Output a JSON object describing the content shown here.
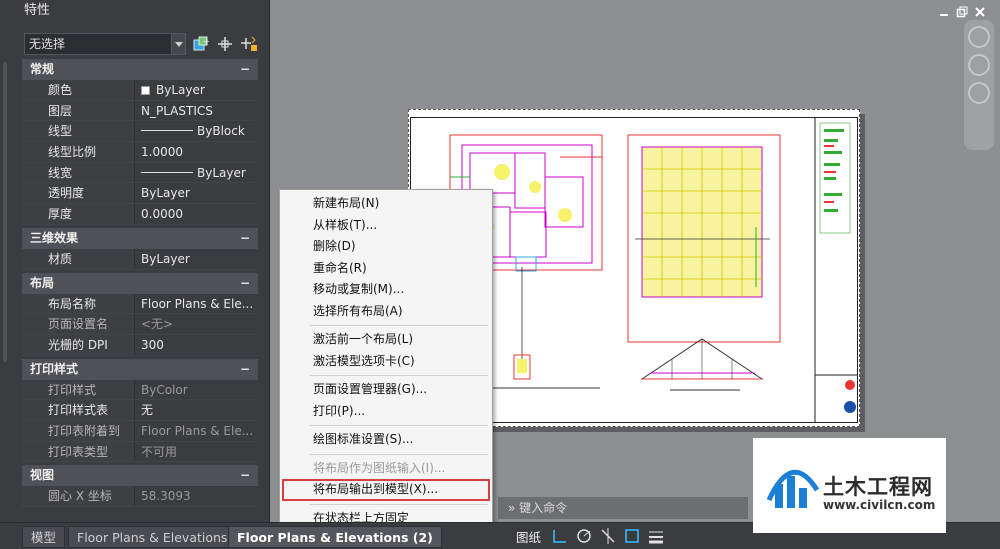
{
  "palette": {
    "title": "特性",
    "selection": "无选择",
    "sections": [
      {
        "header": "常规",
        "rows": [
          {
            "name": "颜色",
            "value": "ByLayer",
            "kind": "color"
          },
          {
            "name": "图层",
            "value": "N_PLASTICS"
          },
          {
            "name": "线型",
            "value": "ByBlock",
            "kind": "line"
          },
          {
            "name": "线型比例",
            "value": "1.0000"
          },
          {
            "name": "线宽",
            "value": "ByLayer",
            "kind": "line"
          },
          {
            "name": "透明度",
            "value": "ByLayer"
          },
          {
            "name": "厚度",
            "value": "0.0000"
          }
        ]
      },
      {
        "header": "三维效果",
        "rows": [
          {
            "name": "材质",
            "value": "ByLayer"
          }
        ]
      },
      {
        "header": "布局",
        "rows": [
          {
            "name": "布局名称",
            "value": "Floor Plans & Ele..."
          },
          {
            "name": "页面设置名",
            "value": "<无>",
            "dim": true
          },
          {
            "name": "光栅的 DPI",
            "value": "300"
          }
        ]
      },
      {
        "header": "打印样式",
        "rows": [
          {
            "name": "打印样式",
            "value": "ByColor",
            "dim": true
          },
          {
            "name": "打印样式表",
            "value": "无"
          },
          {
            "name": "打印表附着到",
            "value": "Floor Plans & Ele...",
            "dim": true
          },
          {
            "name": "打印表类型",
            "value": "不可用",
            "dim": true
          }
        ]
      },
      {
        "header": "视图",
        "rows": [
          {
            "name": "圆心 X 坐标",
            "value": "58.3093",
            "dim": true
          }
        ]
      }
    ],
    "collapse_glyph": "−"
  },
  "context_menu": {
    "items": [
      {
        "label": "新建布局(N)"
      },
      {
        "label": "从样板(T)..."
      },
      {
        "label": "删除(D)"
      },
      {
        "label": "重命名(R)"
      },
      {
        "label": "移动或复制(M)..."
      },
      {
        "label": "选择所有布局(A)"
      },
      {
        "sep": true
      },
      {
        "label": "激活前一个布局(L)"
      },
      {
        "label": "激活模型选项卡(C)"
      },
      {
        "sep": true
      },
      {
        "label": "页面设置管理器(G)..."
      },
      {
        "label": "打印(P)..."
      },
      {
        "sep": true
      },
      {
        "label": "绘图标准设置(S)..."
      },
      {
        "sep": true
      },
      {
        "label": "将布局作为图纸输入(I)...",
        "disabled": true
      },
      {
        "label": "将布局输出到模型(X)...",
        "highlighted": true
      },
      {
        "sep": true
      },
      {
        "label": "在状态栏上方固定"
      }
    ]
  },
  "tabs": [
    {
      "label": "模型"
    },
    {
      "label": "Floor Plans & Elevations"
    },
    {
      "label": "Floor Plans & Elevations (2)",
      "active": true
    }
  ],
  "command_line": {
    "placeholder": "键入命令"
  },
  "status_bar": {
    "paper_label": "图纸"
  },
  "watermark": {
    "title": "土木工程网",
    "url": "www.civilcn.com"
  }
}
